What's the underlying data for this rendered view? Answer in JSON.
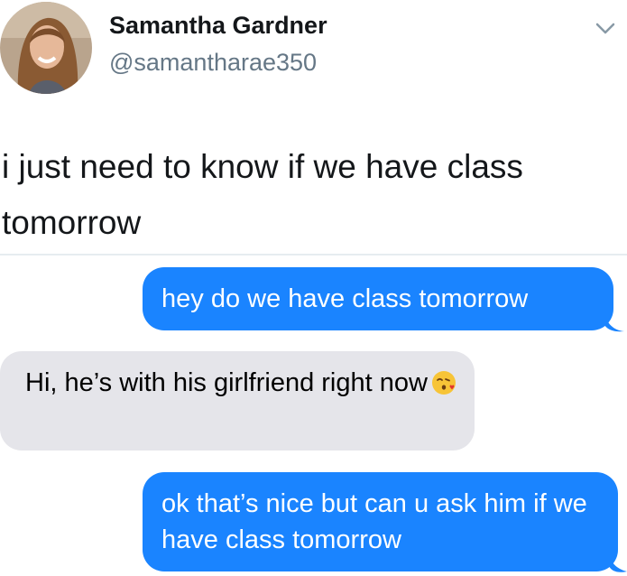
{
  "tweet": {
    "display_name": "Samantha Gardner",
    "handle": "@samantharae350",
    "text": "i just need to know if we have class tomorrow"
  },
  "messages": [
    {
      "direction": "sent",
      "text": "hey do we have class tomorrow"
    },
    {
      "direction": "received",
      "text": "Hi, he’s with his girlfriend right now",
      "emoji": "kissing-face-icon"
    },
    {
      "direction": "sent",
      "text": "ok that’s nice but can u ask him if we have class tomorrow"
    }
  ],
  "colors": {
    "sent_bubble": "#1a84ff",
    "received_bubble": "#e5e5ea",
    "handle_gray": "#657786"
  }
}
